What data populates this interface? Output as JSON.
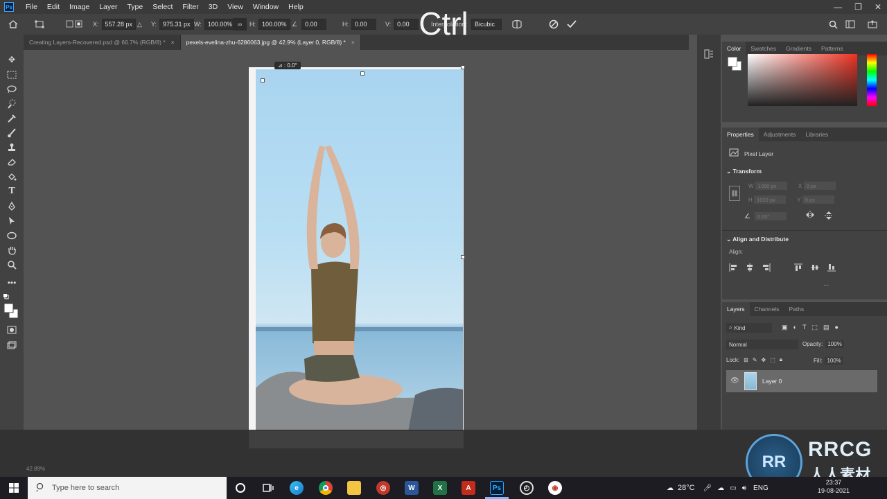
{
  "menubar": {
    "items": [
      "File",
      "Edit",
      "Image",
      "Layer",
      "Type",
      "Select",
      "Filter",
      "3D",
      "View",
      "Window",
      "Help"
    ],
    "window_controls": [
      "—",
      "❐",
      "✕"
    ]
  },
  "options": {
    "x_label": "X:",
    "x_value": "557.28 px",
    "y_label": "Y:",
    "y_value": "975.31 px",
    "w_label": "W:",
    "w_value": "100.00%",
    "h_label": "H:",
    "h_value": "100.00%",
    "angle_value": "0.00",
    "hskew_label": "H:",
    "hskew_value": "0.00",
    "vskew_label": "V:",
    "vskew_value": "0.00",
    "interpolation_label": "Interpolation:",
    "interpolation_value": "Bicubic"
  },
  "tabs": [
    {
      "label": "Creating Layers-Recovered.psd @ 66.7% (RGB/8) *",
      "close": "×"
    },
    {
      "label": "pexels-evelina-zhu-6286063.jpg @ 42.9% (Layer 0, RGB/8) *",
      "close": "×"
    }
  ],
  "canvas": {
    "rotation_readout": "⊿ : 0.0°"
  },
  "color_panel": {
    "tabs": [
      "Color",
      "Swatches",
      "Gradients",
      "Patterns"
    ]
  },
  "properties_panel": {
    "tabs": [
      "Properties",
      "Adjustments",
      "Libraries"
    ],
    "kind_label": "Pixel Layer",
    "transform_title": "Transform",
    "w_label": "W",
    "w_value": "1080 px",
    "x_label": "X",
    "x_value": "0 px",
    "h_label": "H",
    "h_value": "1920 px",
    "y_label": "Y",
    "y_value": "0 px",
    "angle_value": "0.00°",
    "align_title": "Align and Distribute",
    "align_label": "Align:",
    "more": "..."
  },
  "layers_panel": {
    "tabs": [
      "Layers",
      "Channels",
      "Paths"
    ],
    "filter_label": "Kind",
    "blend_mode": "Normal",
    "opacity_label": "Opacity:",
    "opacity_value": "100%",
    "lock_label": "Lock:",
    "fill_label": "Fill:",
    "fill_value": "100%",
    "layers": [
      {
        "name": "Layer 0",
        "visible": true
      }
    ]
  },
  "caption": {
    "text": "Ctrl"
  },
  "statusbar": {
    "text": "42.89%"
  },
  "taskbar": {
    "search_placeholder": "Type here to search",
    "weather": "28°C",
    "language": "ENG",
    "time": "23:37",
    "date": "19-08-2021"
  },
  "watermark": {
    "badge": "RR",
    "title": "RRCG",
    "subtitle": "人人素材"
  },
  "colors": {
    "accent": "#31a8ff",
    "panel_bg": "#424242",
    "canvas_bg": "#535353"
  }
}
